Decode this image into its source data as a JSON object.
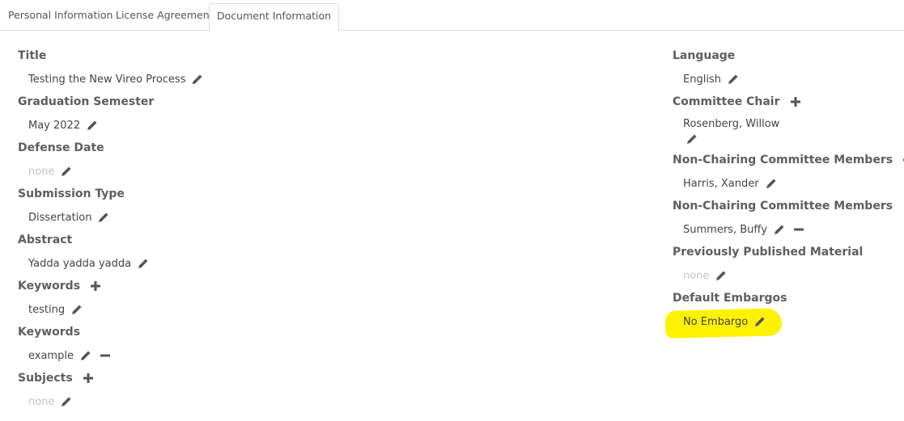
{
  "tabs": [
    {
      "label": "Personal Information",
      "active": false
    },
    {
      "label": "License Agreement",
      "active": false
    },
    {
      "label": "Document Information",
      "active": true
    }
  ],
  "left_fields": [
    {
      "label": "Title",
      "value": "Testing the New Vireo Process"
    },
    {
      "label": "Graduation Semester",
      "value": "May 2022"
    },
    {
      "label": "Defense Date",
      "value": "none"
    },
    {
      "label": "Submission Type",
      "value": "Dissertation"
    },
    {
      "label": "Abstract",
      "value": "Yadda yadda yadda"
    },
    {
      "label": "Keywords",
      "value": "testing"
    },
    {
      "label": "Keywords",
      "value": "example"
    },
    {
      "label": "Subjects",
      "value": "none"
    }
  ],
  "right_fields": [
    {
      "label": "Language",
      "value": "English"
    },
    {
      "label": "Committee Chair",
      "value": "Rosenberg, Willow"
    },
    {
      "label": "Non-Chairing Committee Members",
      "value": "Harris, Xander"
    },
    {
      "label": "Non-Chairing Committee Members",
      "value": "Summers, Buffy"
    },
    {
      "label": "Previously Published Material",
      "value": "none"
    },
    {
      "label": "Default Embargos",
      "value": "No Embargo"
    }
  ],
  "colors": {
    "highlight": "#fff200",
    "icon": "#555555",
    "none_text": "#c4c4c4"
  }
}
